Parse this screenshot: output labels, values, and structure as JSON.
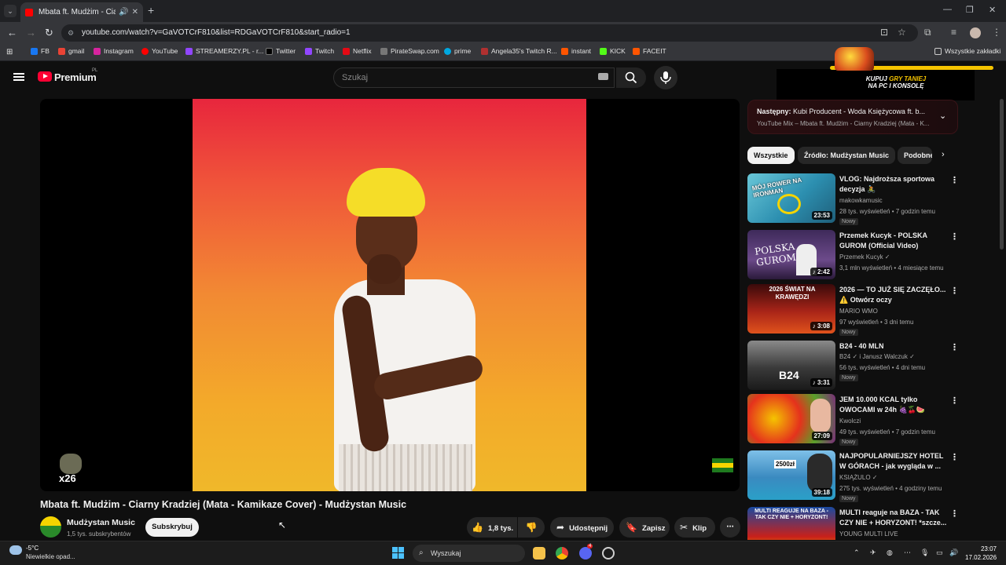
{
  "browser": {
    "tab_title": "Mbata ft. Mudżim - Ciarny Kradziej",
    "url": "youtube.com/watch?v=GaVOTCrF810&list=RDGaVOTCrF810&start_radio=1",
    "bookmarks": [
      {
        "label": "FB",
        "color": "#1877f2"
      },
      {
        "label": "gmail",
        "color": "#ea4335"
      },
      {
        "label": "Instagram",
        "color": "#d6249f"
      },
      {
        "label": "YouTube",
        "color": "#ff0000"
      },
      {
        "label": "STREAMERZY.PL - r...",
        "color": "#9146ff"
      },
      {
        "label": "Twitter",
        "color": "#000000"
      },
      {
        "label": "Twitch",
        "color": "#9146ff"
      },
      {
        "label": "Netflix",
        "color": "#e50914"
      },
      {
        "label": "PirateSwap.com",
        "color": "#777777"
      },
      {
        "label": "prime",
        "color": "#00a8e1"
      },
      {
        "label": "Angela35's Twitch R...",
        "color": "#b03030"
      },
      {
        "label": "instant",
        "color": "#ff5500"
      },
      {
        "label": "KICK",
        "color": "#53fc18"
      },
      {
        "label": "FACEIT",
        "color": "#ff5500"
      }
    ],
    "all_bookmarks": "Wszystkie zakładki"
  },
  "youtube": {
    "logo_text": "Premium",
    "logo_region": "PL",
    "search_placeholder": "Szukaj"
  },
  "ad": {
    "line1_prefix": "KUPUJ ",
    "line1_highlight": "GRY TANIEJ",
    "line2": "NA PC I KONSOLĘ"
  },
  "player": {
    "watermark": "x26"
  },
  "video": {
    "title": "Mbata ft. Mudżim - Ciarny Kradziej (Mata - Kamikaze Cover) - Mudżystan Music",
    "channel": "Mudżystan Music",
    "subscribers": "1,5 tys. subskrybentów",
    "subscribe_label": "Subskrybuj",
    "likes": "1,8 tys.",
    "share_label": "Udostępnij",
    "save_label": "Zapisz",
    "clip_label": "Klip"
  },
  "up_next": {
    "label": "Następny:",
    "title": "Kubi Producent - Woda Księżycowa ft. b...",
    "subtitle": "YouTube Mix – Mbata ft. Mudżim - Ciarny Kradziej (Mata - K..."
  },
  "chips": [
    "Wszystkie",
    "Źródło: Mudżystan Music",
    "Podobne"
  ],
  "recommendations": [
    {
      "title": "VLOG: Najdroższa sportowa decyzja 🚴",
      "channel": "makowkamusic",
      "meta": "28 tys. wyświetleń • 7 godzin temu",
      "badge": "Nowy",
      "duration": "23:53",
      "thumb_text": "MÓJ ROWER NA IRONMAN"
    },
    {
      "title": "Przemek Kucyk - POLSKA GUROM (Official Video)",
      "channel": "Przemek Kucyk ✓",
      "meta": "3,1 mln wyświetleń • 4 miesiące temu",
      "badge": "",
      "duration": "2:42",
      "thumb_text": "POLSKA GUROM"
    },
    {
      "title": "2026 — TO JUŻ SIĘ ZACZĘŁO... ⚠️ Otwórz oczy",
      "channel": "MARIO WMO",
      "meta": "97 wyświetleń • 3 dni temu",
      "badge": "Nowy",
      "duration": "3:08",
      "thumb_text": "2026 ŚWIAT NA KRAWĘDZI"
    },
    {
      "title": "B24 - 40 MLN",
      "channel": "B24 ✓ i Janusz Walczuk ✓",
      "meta": "56 tys. wyświetleń • 4 dni temu",
      "badge": "Nowy",
      "duration": "3:31",
      "thumb_text": "B24"
    },
    {
      "title": "JEM 10.000 KCAL tylko OWOCAMI w 24h 🍇🍒🍉",
      "channel": "Kwolczi",
      "meta": "49 tys. wyświetleń • 7 godzin temu",
      "badge": "Nowy",
      "duration": "27:09",
      "thumb_text": ""
    },
    {
      "title": "NAJPOPULARNIEJSZY HOTEL W GÓRACH - jak wygląda w ...",
      "channel": "KSIĄŻULO ✓",
      "meta": "275 tys. wyświetleń • 4 godziny temu",
      "badge": "Nowy",
      "duration": "39:18",
      "thumb_text": "2500zł"
    },
    {
      "title": "MULTI reaguje na BAZA - TAK CZY NIE + HORYZONT! *szcze...",
      "channel": "YOUNG MULTI LIVE",
      "meta": "",
      "badge": "",
      "duration": "",
      "thumb_text": "MULTI REAGUJE NA BAZA - TAK CZY NIE + HORYZONT!"
    }
  ],
  "taskbar": {
    "temp": "-5°C",
    "weather": "Niewielkie opad...",
    "search": "Wyszukaj",
    "time": "23:07",
    "date": "17.02.2026",
    "chrome_badge": "4"
  },
  "colors": {
    "yt_red": "#ff0033",
    "accent_yellow": "#f5c400"
  }
}
